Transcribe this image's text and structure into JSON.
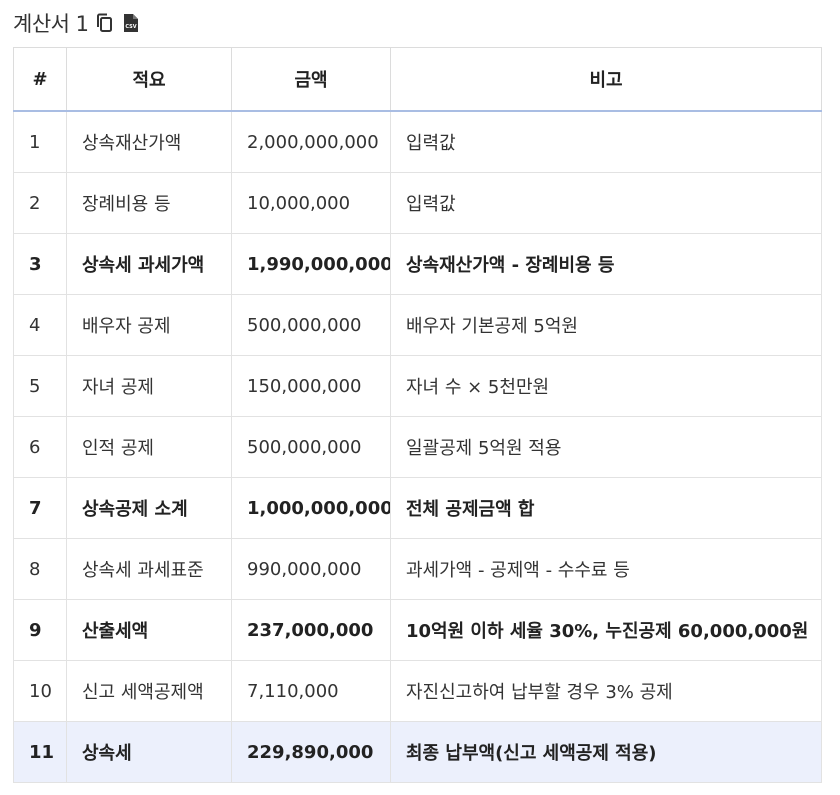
{
  "header": {
    "title": "계산서 1"
  },
  "table": {
    "columns": [
      "#",
      "적요",
      "금액",
      "비고"
    ],
    "rows": [
      {
        "no": "1",
        "item": "상속재산가액",
        "amount": "2,000,000,000",
        "note": "입력값",
        "style": "normal"
      },
      {
        "no": "2",
        "item": "장례비용 등",
        "amount": "10,000,000",
        "note": "입력값",
        "style": "normal"
      },
      {
        "no": "3",
        "item": "상속세 과세가액",
        "amount": "1,990,000,000",
        "note": "상속재산가액 - 장례비용 등",
        "style": "bold"
      },
      {
        "no": "4",
        "item": "배우자 공제",
        "amount": "500,000,000",
        "note": "배우자 기본공제 5억원",
        "style": "normal"
      },
      {
        "no": "5",
        "item": "자녀 공제",
        "amount": "150,000,000",
        "note": "자녀 수 × 5천만원",
        "style": "normal"
      },
      {
        "no": "6",
        "item": "인적 공제",
        "amount": "500,000,000",
        "note": "일괄공제 5억원 적용",
        "style": "normal"
      },
      {
        "no": "7",
        "item": "상속공제 소계",
        "amount": "1,000,000,000",
        "note": "전체 공제금액 합",
        "style": "bold"
      },
      {
        "no": "8",
        "item": "상속세 과세표준",
        "amount": "990,000,000",
        "note": "과세가액 - 공제액 - 수수료 등",
        "style": "normal"
      },
      {
        "no": "9",
        "item": "산출세액",
        "amount": "237,000,000",
        "note": "10억원 이하 세율 30%, 누진공제 60,000,000원",
        "style": "bold"
      },
      {
        "no": "10",
        "item": "신고 세액공제액",
        "amount": "7,110,000",
        "note": "자진신고하여 납부할 경우 3% 공제",
        "style": "normal"
      },
      {
        "no": "11",
        "item": "상속세",
        "amount": "229,890,000",
        "note": "최종 납부액(신고 세액공제 적용)",
        "style": "final"
      }
    ]
  },
  "colors": {
    "header_underline": "#a9bde3",
    "final_row_bg": "#ecf0fc",
    "border": "#e2e2e2"
  }
}
